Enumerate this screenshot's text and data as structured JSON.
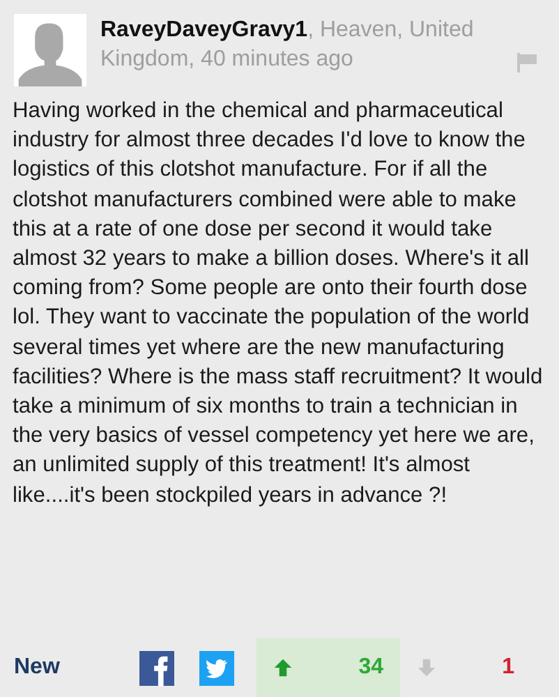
{
  "comment": {
    "author": "RaveyDaveyGravy1",
    "meta": ", Heaven, United Kingdom, 40 minutes ago",
    "text": "Having worked in the chemical and pharmaceutical industry for almost three decades I'd love to know the logistics of this clotshot manufacture. For if all the clotshot manufacturers combined were able to make this at a rate of one dose per second it would take almost 32 years to make a billion doses. Where's it all coming from? Some people are onto their fourth dose lol. They want to vaccinate the population of the world several times yet where are the new manufacturing facilities? Where is the mass staff recruitment? It would take a minimum of six months to train a technician in the very basics of vessel competency yet here we are, an unlimited supply of this treatment! It's almost like....it's been stockpiled years in advance ?!"
  },
  "footer": {
    "sort_label": "New",
    "votes": [
      {
        "kind": "up",
        "count": "34",
        "selected": true
      },
      {
        "kind": "down",
        "count": "1",
        "selected": false
      }
    ]
  }
}
